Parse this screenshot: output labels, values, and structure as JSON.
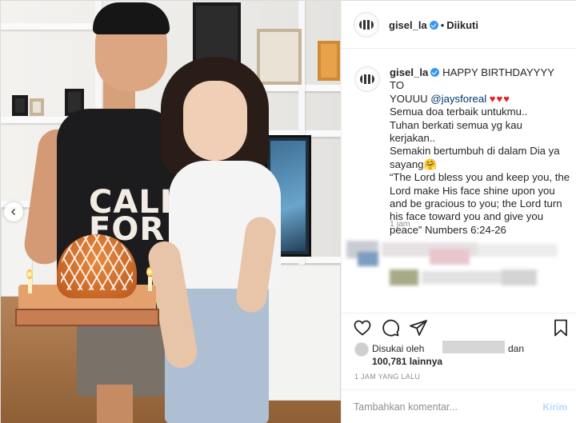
{
  "post": {
    "username": "gisel_la",
    "follow_status": "Diikuti",
    "dot": "•",
    "caption_lines": [
      "HAPPY BIRTHDAYYYY TO",
      "YOUUU",
      "Semua doa terbaik untukmu..",
      "Tuhan berkati semua yg kau kerjakan..",
      "Semakin bertumbuh di dalam Dia ya",
      "sayang",
      "“The Lord bless you and keep you, the",
      "Lord make His face shine upon you",
      "and be gracious to you; the Lord turn",
      "his face toward you and give you",
      "peace” Numbers 6:24-26"
    ],
    "mention": "@jaysforeal",
    "hearts": "♥♥♥",
    "emoji": "🤗",
    "comment_time": "1 jam",
    "liked_by_prefix": "Disukai oleh",
    "liked_by_and": "dan",
    "likes_count": "100,781 lainnya",
    "posted_ago": "1 JAM YANG LALU",
    "comment_placeholder": "Tambahkan komentar...",
    "post_button": "Kirim"
  },
  "photo": {
    "shirt_text_1": "CALI",
    "shirt_text_2": "FOR"
  },
  "icons": {
    "like": "heart-icon",
    "comment": "comment-icon",
    "share": "share-icon",
    "save": "bookmark-icon",
    "prev": "chevron-left-icon",
    "verified": "verified-badge-icon"
  },
  "colors": {
    "verified": "#3897f0",
    "mention": "#00376b",
    "heart": "#ed1c24",
    "muted": "#8e8e8e",
    "post_button": "#b3dbff"
  }
}
